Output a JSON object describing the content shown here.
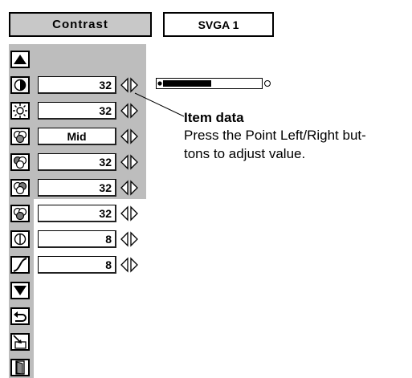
{
  "header": {
    "menu_title": "Contrast",
    "signal_mode": "SVGA 1"
  },
  "items": [
    {
      "icon": "contrast-icon",
      "value": "32"
    },
    {
      "icon": "brightness-icon",
      "value": "32"
    },
    {
      "icon": "color-temp-icon",
      "value": "Mid"
    },
    {
      "icon": "white-balance-red-icon",
      "value": "32"
    },
    {
      "icon": "white-balance-green-icon",
      "value": "32"
    },
    {
      "icon": "white-balance-blue-icon",
      "value": "32"
    },
    {
      "icon": "sharpness-icon",
      "value": "8"
    },
    {
      "icon": "gamma-icon",
      "value": "8"
    }
  ],
  "side_icons": [
    "scroll-up-icon",
    "scroll-down-icon",
    "reset-icon",
    "store-icon",
    "quit-icon"
  ],
  "slider": {
    "level_fraction": 0.5
  },
  "callout": {
    "title": "Item data",
    "line1": "Press the Point Left/Right but-",
    "line2": "tons to adjust value."
  }
}
